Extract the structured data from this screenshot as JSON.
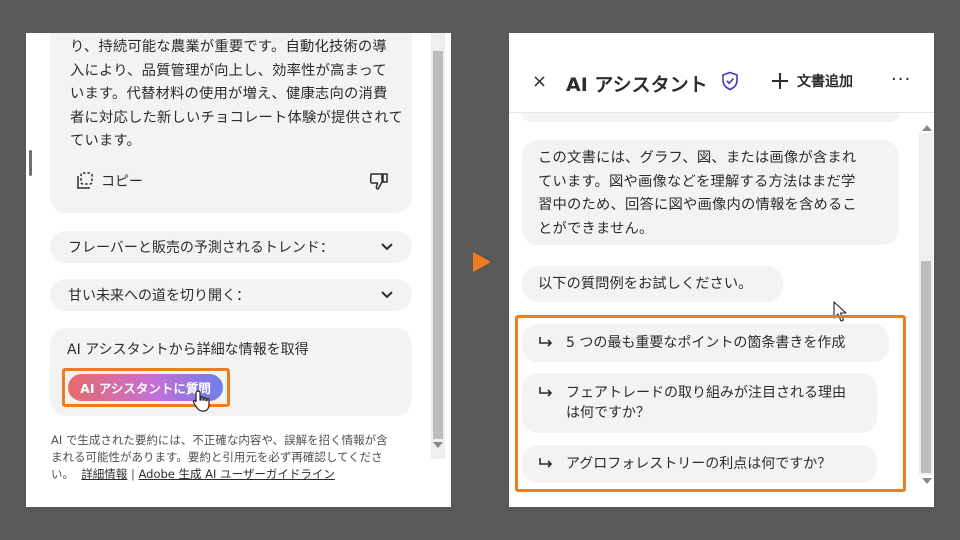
{
  "left": {
    "answer_lines": [
      "り、持続可能な農業が重要です。自動化技術の導",
      "入により、品質管理が向上し、効率性が高まって",
      "います。代替材料の使用が増え、健康志向の消費",
      "者に対応した新しいチョコレート体験が提供されて",
      "ています。"
    ],
    "copy_label": "コピー",
    "accordions": [
      {
        "label": "フレーバーと販売の予測されるトレンド："
      },
      {
        "label": "甘い未来への道を切り開く："
      }
    ],
    "ask_title": "AI アシスタントから詳細な情報を取得",
    "ask_button": "AI アシスタントに質問",
    "disclaimer_lines": [
      "AI で生成された要約には、不正確な内容や、誤解を招く情報が含",
      "まれる可能性があります。要約と引用元を必ず再確認してくださ"
    ],
    "disclaimer_end": "い。",
    "link_details": "詳細情報",
    "separator": "|",
    "link_guidelines": "Adobe 生成 AI ユーザーガイドライン"
  },
  "right": {
    "close": "×",
    "title": "AI アシスタント",
    "add_doc": "文書追加",
    "more": "···",
    "info_lines": [
      "この文書には、グラフ、図、または画像が含まれ",
      "ています。図や画像などを理解する方法はまだ学",
      "習中のため、回答に図や画像内の情報を含めるこ",
      "とができません。"
    ],
    "try_text": "以下の質問例をお試しください。",
    "suggestions": [
      {
        "lines": [
          "5 つの最も重要なポイントの箇条書きを作成"
        ]
      },
      {
        "lines": [
          "フェアトレードの取り組みが注目される理由",
          "は何ですか？"
        ]
      },
      {
        "lines": [
          "アグロフォレストリーの利点は何ですか？"
        ]
      }
    ]
  },
  "colors": {
    "highlight": "#ef7d1e",
    "arrow": "#f07b1a",
    "background": "#595959",
    "bubble": "#f3f3f3"
  },
  "icons": [
    "copy-icon",
    "thumbs-down-icon",
    "chevron-down-icon",
    "hand-cursor-icon",
    "close-icon",
    "shield-icon",
    "plus-icon",
    "more-icon",
    "reply-arrow-icon",
    "pointer-cursor-icon"
  ]
}
